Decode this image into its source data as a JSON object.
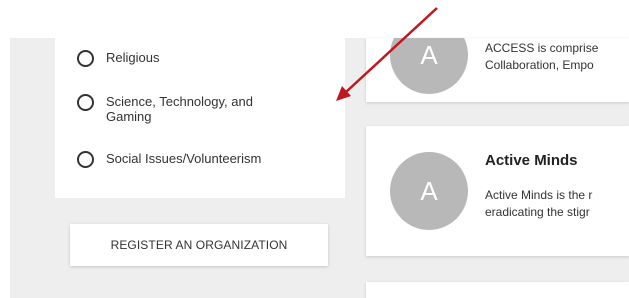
{
  "filters": {
    "options": [
      {
        "label": "Religious"
      },
      {
        "label": "Science, Technology, and\nGaming"
      },
      {
        "label": "Social Issues/Volunteerism"
      }
    ]
  },
  "register_button": {
    "label": "REGISTER AN ORGANIZATION"
  },
  "organizations": [
    {
      "avatar_letter": "A",
      "name": "",
      "description": "ACCESS is comprise\nCollaboration, Empo"
    },
    {
      "avatar_letter": "A",
      "name": "Active Minds",
      "description": "Active Minds is the r\neradicating the stigr"
    },
    {
      "avatar_letter": "",
      "name": "",
      "description": ""
    }
  ],
  "colors": {
    "annotation_arrow": "#c0161d",
    "avatar_bg": "#b8b8b8",
    "page_bg": "#eeeeee"
  }
}
